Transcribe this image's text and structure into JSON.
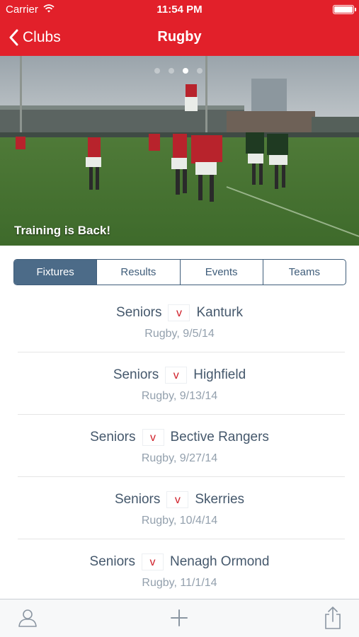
{
  "status_bar": {
    "carrier": "Carrier",
    "time": "11:54 PM"
  },
  "nav": {
    "back_label": "Clubs",
    "title": "Rugby"
  },
  "hero": {
    "caption": "Training is Back!",
    "page_count": 4,
    "active_page": 3
  },
  "tabs": [
    {
      "label": "Fixtures",
      "selected": true
    },
    {
      "label": "Results",
      "selected": false
    },
    {
      "label": "Events",
      "selected": false
    },
    {
      "label": "Teams",
      "selected": false
    }
  ],
  "fixtures": [
    {
      "home": "Seniors",
      "vs": "v",
      "away": "Kanturk",
      "detail": "Rugby, 9/5/14"
    },
    {
      "home": "Seniors",
      "vs": "v",
      "away": "Highfield",
      "detail": "Rugby, 9/13/14"
    },
    {
      "home": "Seniors",
      "vs": "v",
      "away": "Bective Rangers",
      "detail": "Rugby, 9/27/14"
    },
    {
      "home": "Seniors",
      "vs": "v",
      "away": "Skerries",
      "detail": "Rugby, 10/4/14"
    },
    {
      "home": "Seniors",
      "vs": "v",
      "away": "Nenagh Ormond",
      "detail": "Rugby, 11/1/14"
    }
  ],
  "toolbar": {
    "icons": [
      "person-icon",
      "plus-icon",
      "share-icon"
    ]
  },
  "colors": {
    "brand_red": "#e2202a",
    "segment_blue": "#4c6b88",
    "text_dark": "#45586c",
    "text_muted": "#93a0ad"
  }
}
